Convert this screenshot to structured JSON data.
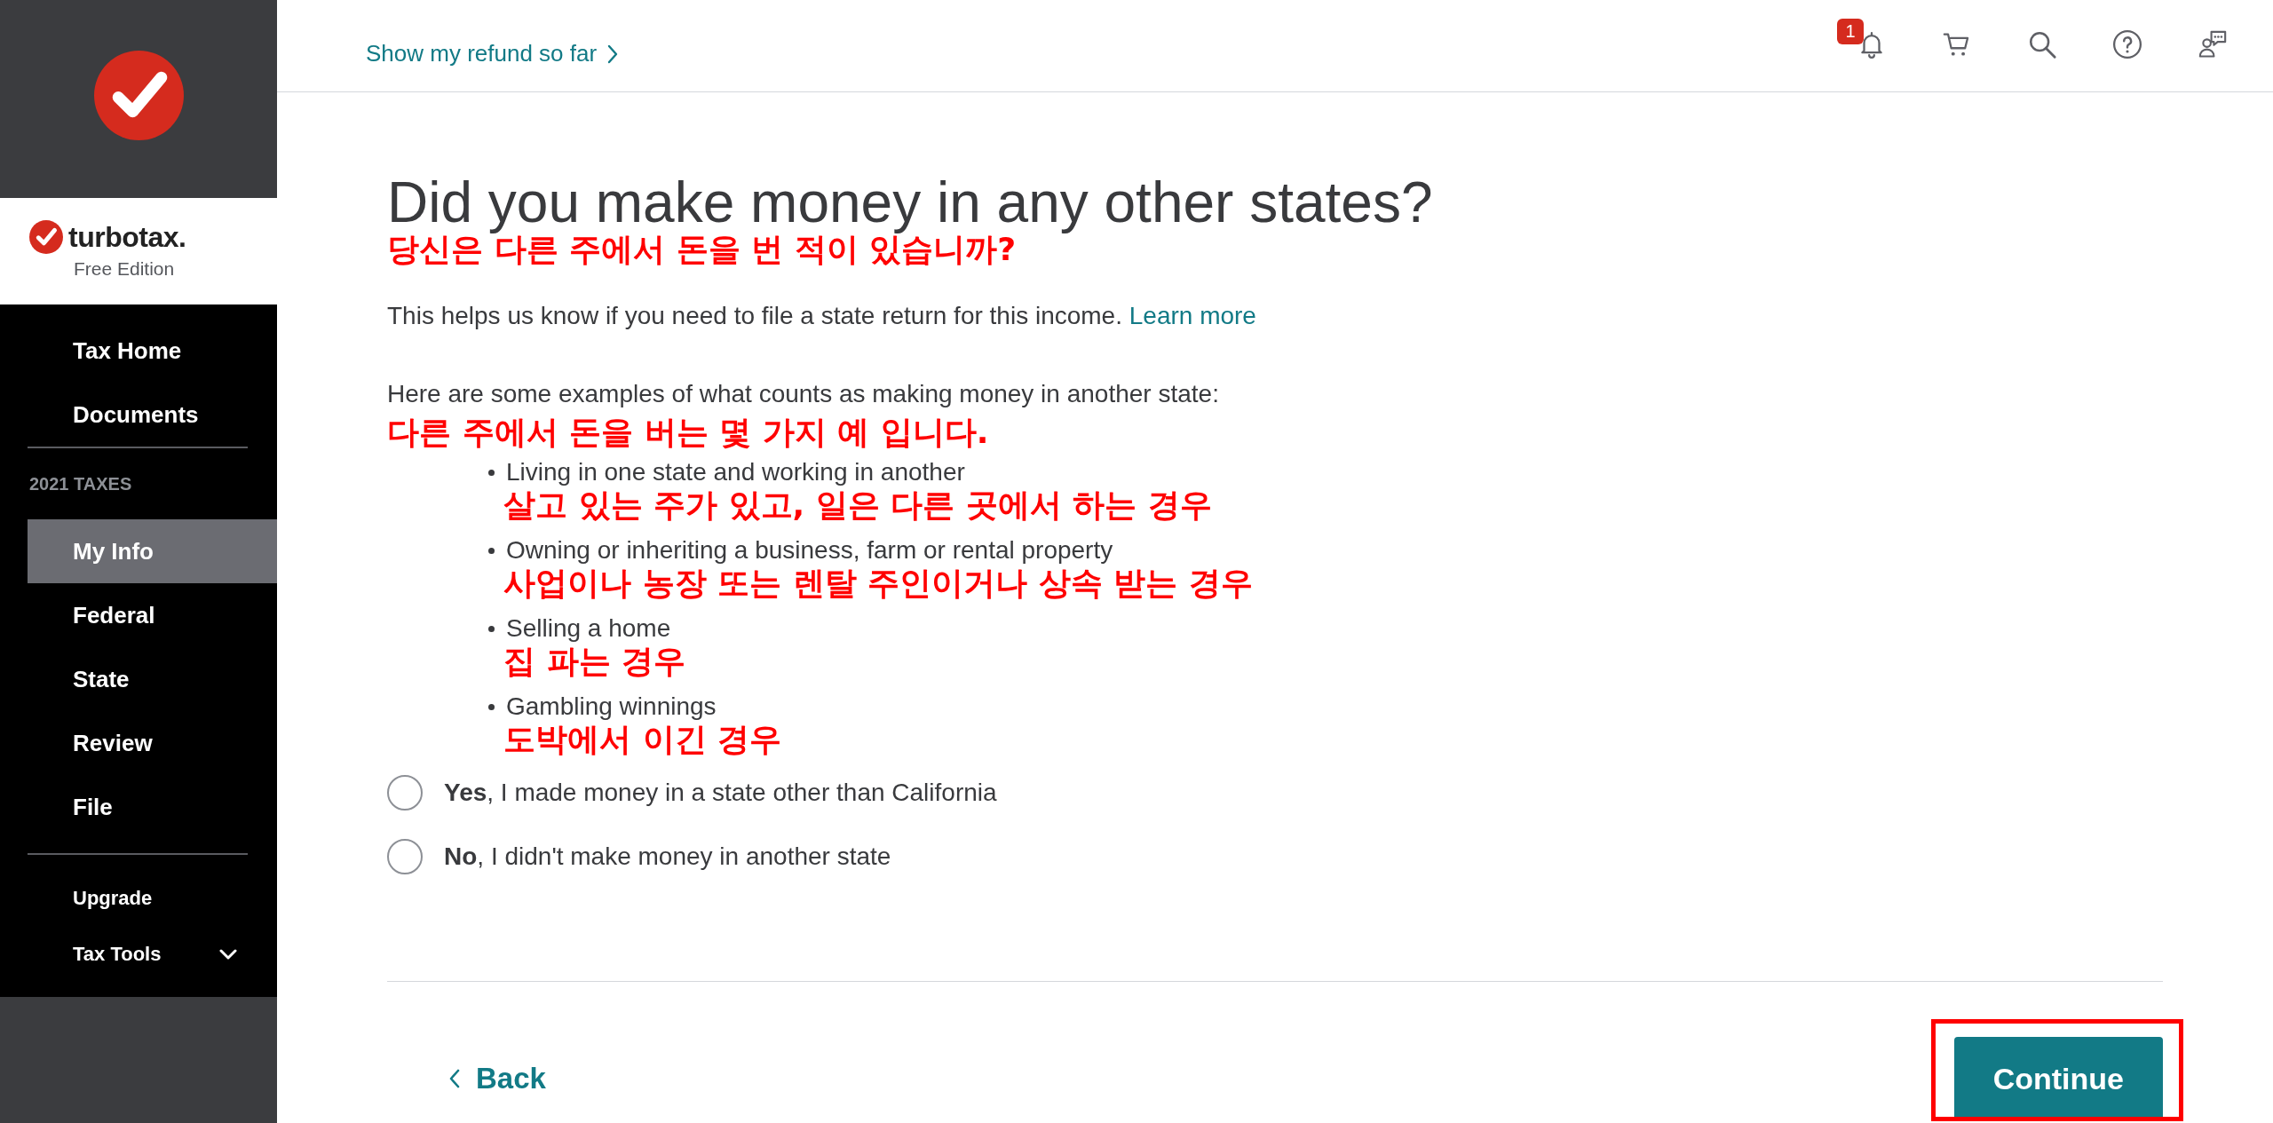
{
  "sidebar": {
    "brand": {
      "wordmark": "turbotax.",
      "edition": "Free Edition"
    },
    "top_links": [
      {
        "label": "Tax Home",
        "selected": false
      },
      {
        "label": "Documents",
        "selected": false
      }
    ],
    "section_heading": "2021 TAXES",
    "steps": [
      {
        "label": "My Info",
        "selected": true
      },
      {
        "label": "Federal",
        "selected": false
      },
      {
        "label": "State",
        "selected": false
      },
      {
        "label": "Review",
        "selected": false
      },
      {
        "label": "File",
        "selected": false
      }
    ],
    "bottom_links": [
      {
        "label": "Upgrade",
        "kind": "link"
      },
      {
        "label": "Tax Tools",
        "kind": "dropdown"
      }
    ]
  },
  "topbar": {
    "refund_link": "Show my refund so far",
    "notification_badge": "1"
  },
  "question": {
    "title": "Did you make money in any other states?",
    "title_annotation": "당신은 다른 주에서 돈을 번 적이 있습니까?",
    "intro": "This helps us know if you need to file a state return for this income.",
    "intro_link": "Learn more",
    "examples_intro": "Here are some examples of what counts as making money in another state:",
    "examples_intro_annotation": "다른 주에서 돈을 버는 몇 가지 예 입니다.",
    "examples": [
      {
        "text": "Living in one state and working in another",
        "annotation": "살고 있는 주가 있고, 일은 다른 곳에서 하는 경우"
      },
      {
        "text": "Owning or inheriting a business, farm or rental property",
        "annotation": "사업이나 농장 또는 렌탈 주인이거나 상속 받는 경우"
      },
      {
        "text": "Selling a home",
        "annotation": "집 파는 경우"
      },
      {
        "text": "Gambling winnings",
        "annotation": "도박에서 이긴 경우"
      }
    ],
    "options": [
      {
        "label": "**Yes**, I made money in a state other than California",
        "selected": false
      },
      {
        "label": "**No**, I didn't make money in another state",
        "selected": false
      }
    ]
  },
  "footer": {
    "back": "Back",
    "continue": {
      "label": "Continue",
      "highlighted": true
    }
  }
}
